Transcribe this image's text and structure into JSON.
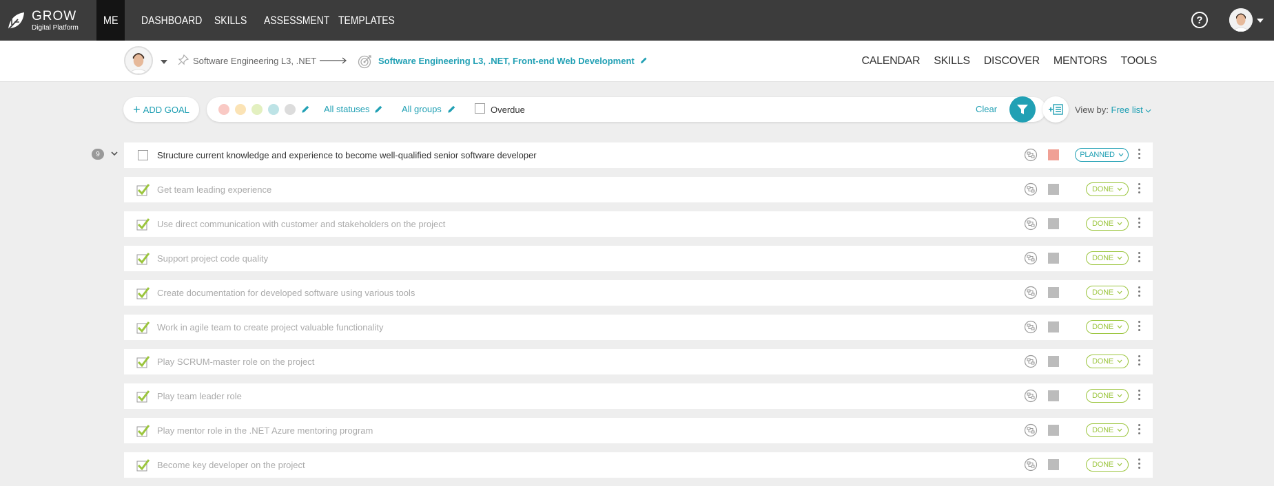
{
  "app": {
    "brand_name": "GROW",
    "brand_sub": "Digital Platform"
  },
  "nav": {
    "items": [
      "ME",
      "DASHBOARD",
      "SKILLS",
      "ASSESSMENT",
      "TEMPLATES"
    ],
    "active": "ME"
  },
  "profile": {
    "current_position": "Software Engineering L3, .NET",
    "target_position": "Software Engineering L3, .NET, Front-end Web Development"
  },
  "sub_links": [
    "CALENDAR",
    "SKILLS",
    "DISCOVER",
    "MENTORS",
    "TOOLS"
  ],
  "filters": {
    "add_goal": "ADD GOAL",
    "color_dots": [
      "#f9c9c4",
      "#fbe3b5",
      "#e3f0c0",
      "#bde3e6",
      "#dcdcdc"
    ],
    "statuses": "All statuses",
    "groups": "All groups",
    "overdue": "Overdue",
    "clear": "Clear",
    "view_by_label": "View by:",
    "view_by_value": "Free list"
  },
  "colors": {
    "accent": "#21a0b4",
    "done": "#9bc53d",
    "planned_square": "#f0a095",
    "done_square": "#bcbcbc"
  },
  "goal_count": "9",
  "goals": [
    {
      "title": "Structure current knowledge and experience to become well-qualified senior software developer",
      "status": "PLANNED",
      "done": false
    },
    {
      "title": "Get team leading experience",
      "status": "DONE",
      "done": true
    },
    {
      "title": "Use direct communication with customer and stakeholders on the project",
      "status": "DONE",
      "done": true
    },
    {
      "title": "Support project code quality",
      "status": "DONE",
      "done": true
    },
    {
      "title": "Create documentation for developed software using various tools",
      "status": "DONE",
      "done": true
    },
    {
      "title": "Work in agile team to create project valuable functionality",
      "status": "DONE",
      "done": true
    },
    {
      "title": "Play SCRUM-master role on the project",
      "status": "DONE",
      "done": true
    },
    {
      "title": "Play team leader role",
      "status": "DONE",
      "done": true
    },
    {
      "title": "Play mentor role in the .NET Azure mentoring program",
      "status": "DONE",
      "done": true
    },
    {
      "title": "Become key developer on the project",
      "status": "DONE",
      "done": true
    }
  ]
}
